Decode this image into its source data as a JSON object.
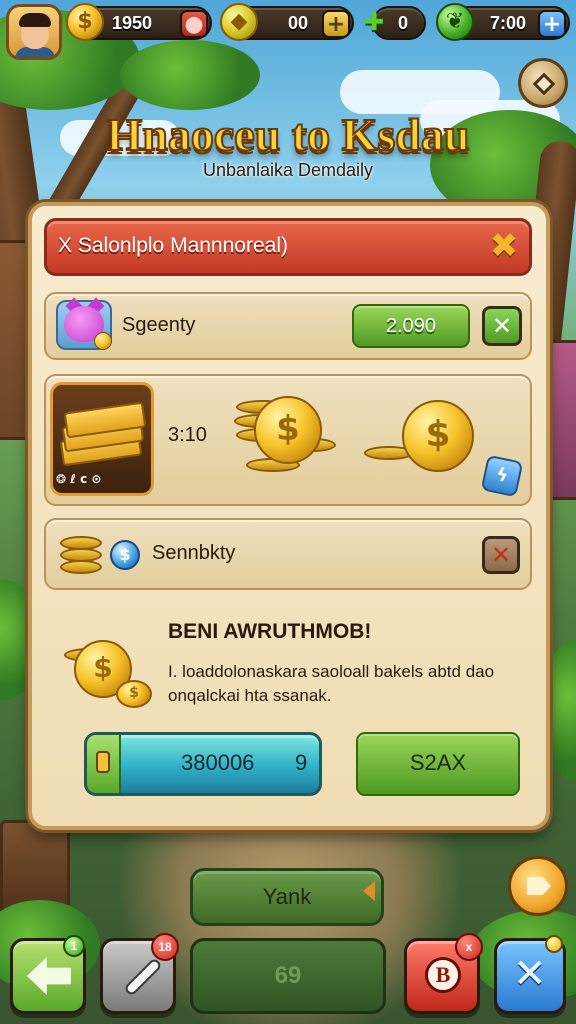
{
  "hud": {
    "coins": "1950",
    "gems": "00",
    "energy": "0",
    "leaves": "7:00",
    "plus": "+"
  },
  "title": "Hnaoceu to Ksdau",
  "subtitle": "Unbanlaika Demdaily",
  "dialog": {
    "header": "X Salonlplo Mannnoreal)",
    "close_glyph": "✖",
    "row1": {
      "label": "Sgeenty",
      "value": "2.090",
      "action_glyph": "✕"
    },
    "row2": {
      "amount": "3:10",
      "badges": "❂ ℓ c ⊙"
    },
    "row3": {
      "label": "Sennbkty",
      "action_glyph": "✕"
    },
    "reward": {
      "title": "BENI AWRUTHMOB!",
      "description": "I. loaddolonaskara saoloall bakels abtd dao onqalckai hta ssanak."
    },
    "price_button": {
      "value": "380006",
      "suffix": "9"
    },
    "confirm_button": "S2AX"
  },
  "bottom": {
    "yank_button": "Yank",
    "center_slot": "69",
    "back_badge": "1",
    "tool_badge": "18",
    "shop_badge": "x",
    "shop_glyph": "B",
    "swap_glyph": "✕"
  },
  "colors": {
    "panel": "#f4e6c4",
    "header_red": "#d8503a",
    "accent_green": "#5aa82a",
    "accent_blue": "#2fb0c8",
    "gold": "#f5c22c"
  },
  "icons": [
    "avatar",
    "gold-coin-icon",
    "ruby-icon",
    "gem-icon",
    "energy-icon",
    "leaf-icon",
    "settings-icon",
    "pet-icon",
    "money-pack-icon",
    "diamond-icon",
    "blue-orb-icon",
    "back-arrow-icon",
    "pickaxe-icon",
    "shop-icon",
    "close-icon"
  ]
}
